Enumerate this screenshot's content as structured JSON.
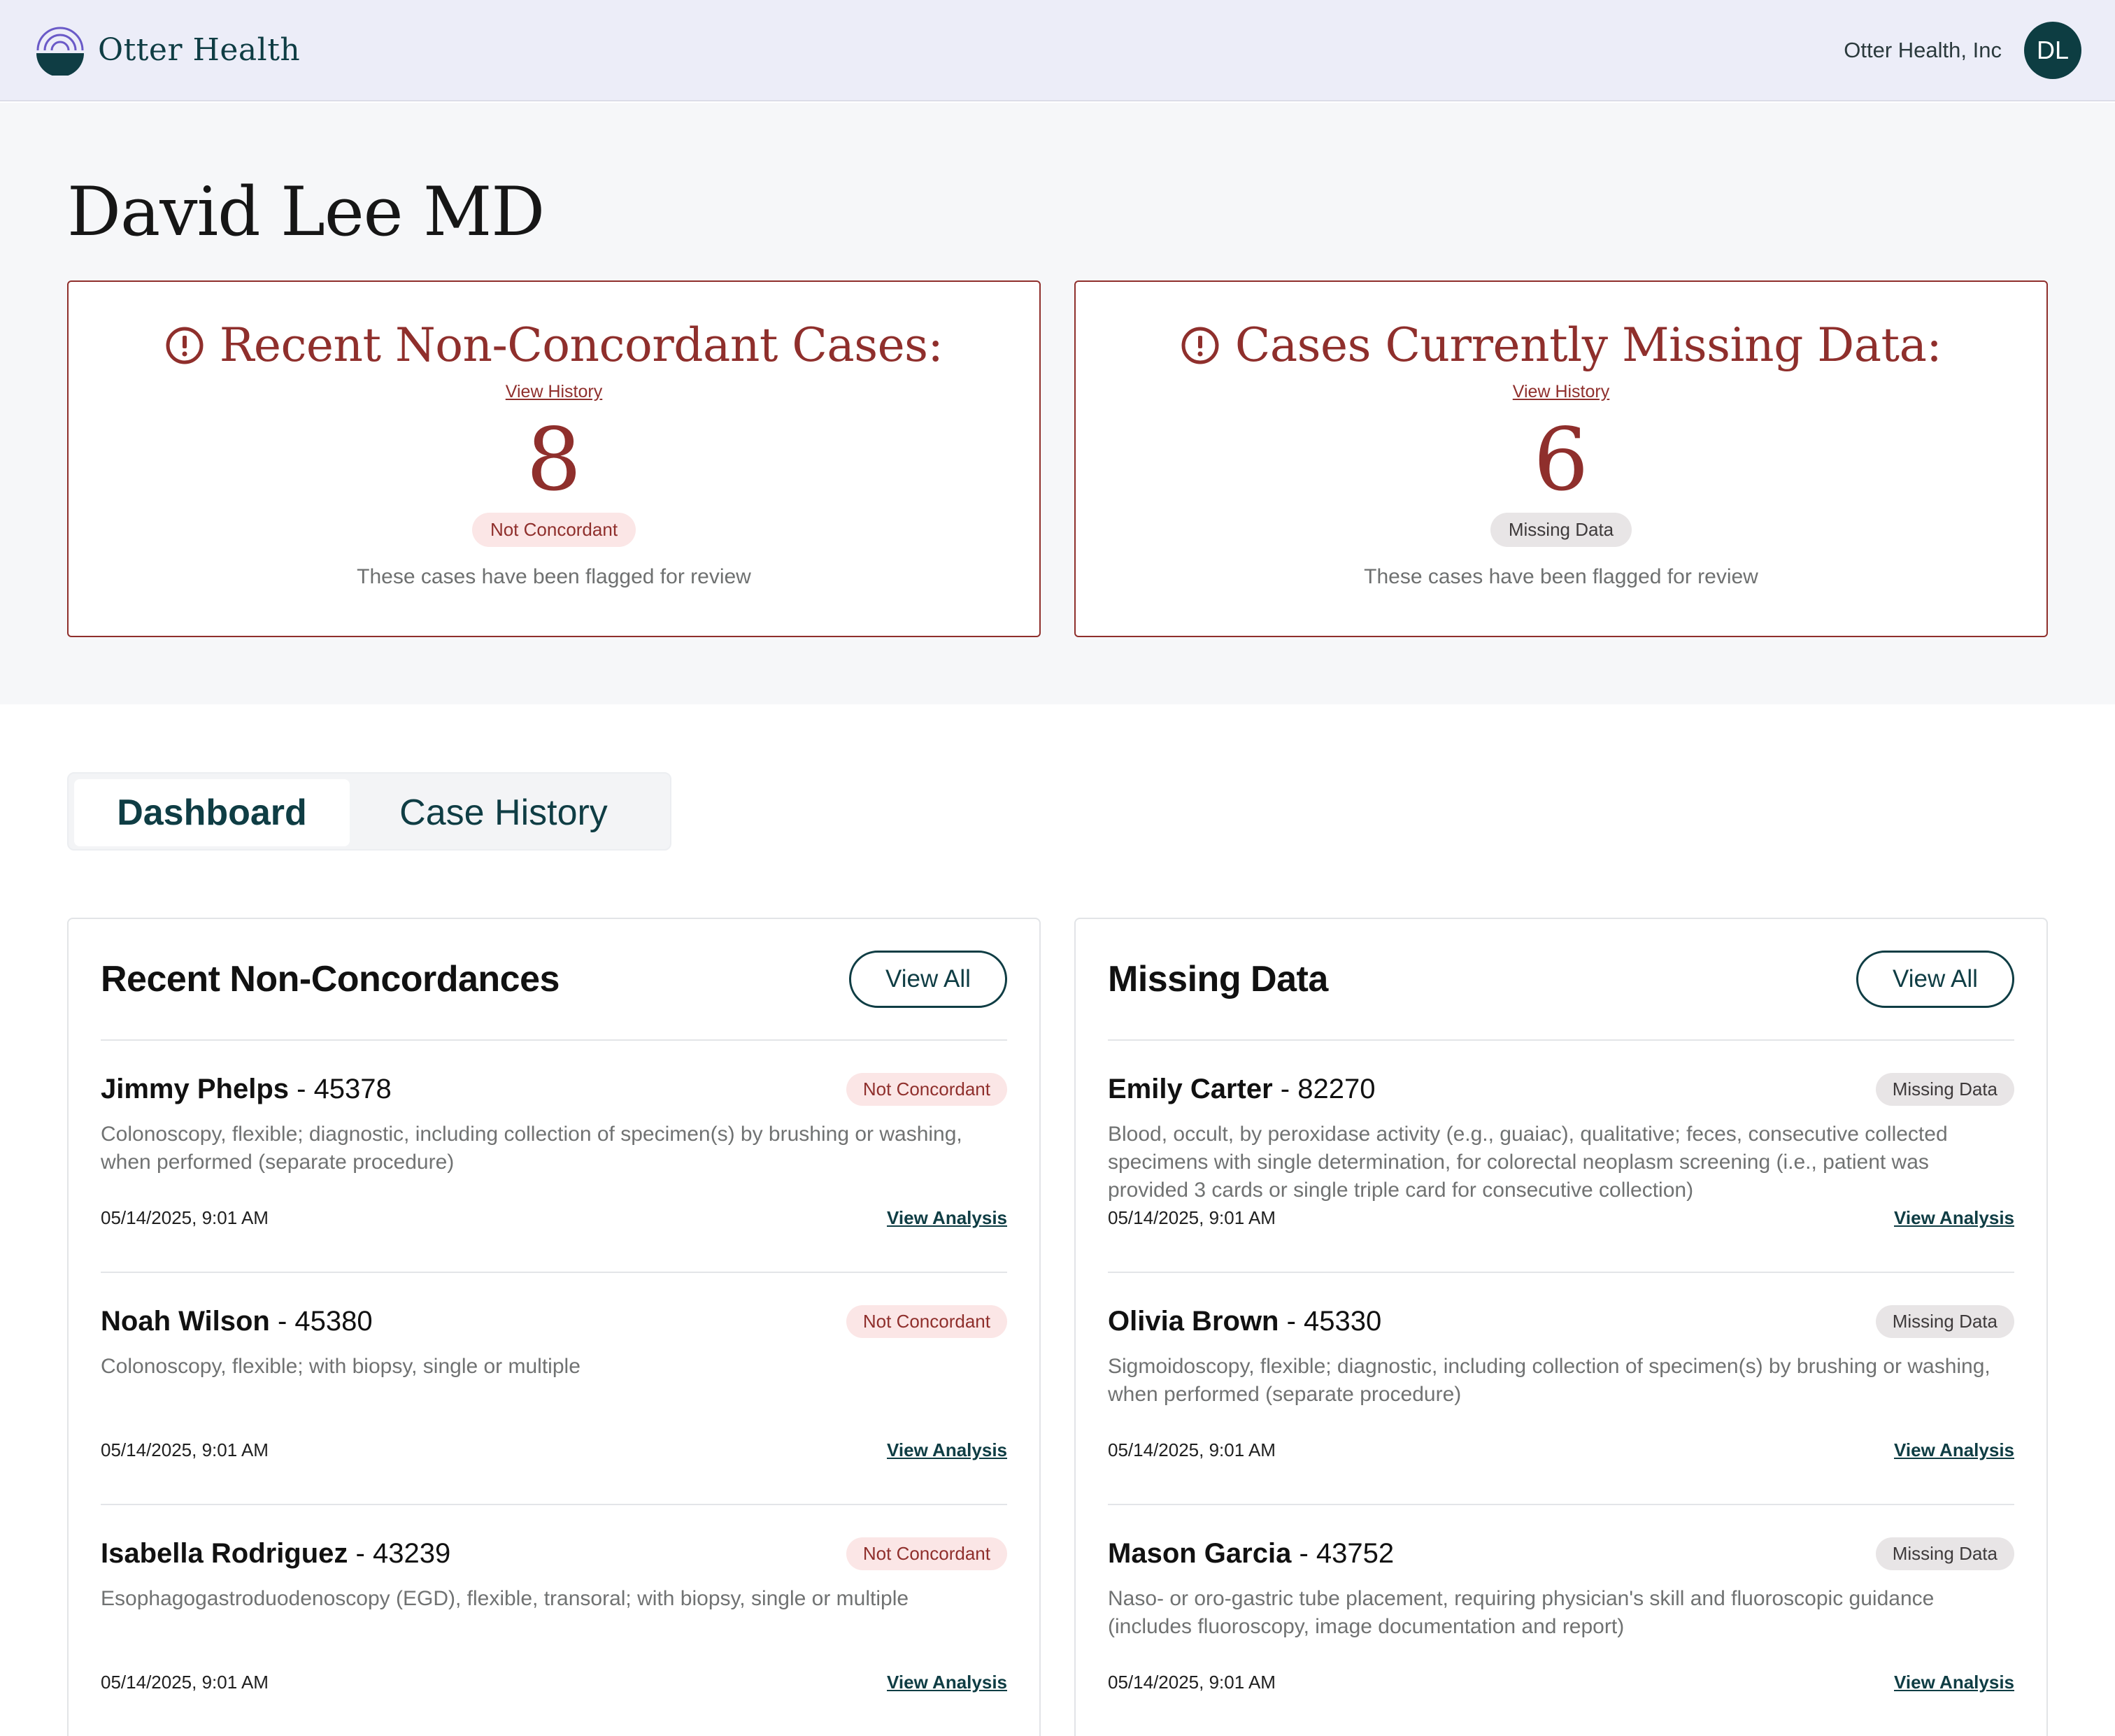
{
  "header": {
    "brand_name": "Otter Health",
    "org_name": "Otter Health, Inc",
    "avatar_initials": "DL"
  },
  "page": {
    "title": "David Lee MD"
  },
  "summary_cards": [
    {
      "title": "Recent Non-Concordant Cases:",
      "link": "View History",
      "count": "8",
      "badge": "Not Concordant",
      "note": "These cases have been flagged for review"
    },
    {
      "title": "Cases Currently Missing Data:",
      "link": "View History",
      "count": "6",
      "badge": "Missing Data",
      "note": "These cases have been flagged for review"
    }
  ],
  "tabs": [
    {
      "label": "Dashboard",
      "active": true
    },
    {
      "label": "Case History",
      "active": false
    }
  ],
  "non_concordances": {
    "title": "Recent Non-Concordances",
    "view_all": "View All",
    "rows": [
      {
        "name": "Jimmy Phelps",
        "id": "45378",
        "badge": "Not Concordant",
        "description": "Colonoscopy, flexible; diagnostic, including collection of specimen(s) by brushing or washing, when performed (separate procedure)",
        "date": "05/14/2025, 9:01 AM",
        "link": "View Analysis"
      },
      {
        "name": "Noah Wilson",
        "id": "45380",
        "badge": "Not Concordant",
        "description": "Colonoscopy, flexible; with biopsy, single or multiple",
        "date": "05/14/2025, 9:01 AM",
        "link": "View Analysis"
      },
      {
        "name": "Isabella Rodriguez",
        "id": "43239",
        "badge": "Not Concordant",
        "description": "Esophagogastroduodenoscopy (EGD), flexible, transoral; with biopsy, single or multiple",
        "date": "05/14/2025, 9:01 AM",
        "link": "View Analysis"
      }
    ]
  },
  "missing_data": {
    "title": "Missing Data",
    "view_all": "View All",
    "rows": [
      {
        "name": "Emily Carter",
        "id": "82270",
        "badge": "Missing Data",
        "description": "Blood, occult, by peroxidase activity (e.g., guaiac), qualitative; feces, consecutive collected specimens with single determination, for colorectal neoplasm screening (i.e., patient was provided 3 cards or single triple card for consecutive collection)",
        "date": "05/14/2025, 9:01 AM",
        "link": "View Analysis"
      },
      {
        "name": "Olivia Brown",
        "id": "45330",
        "badge": "Missing Data",
        "description": "Sigmoidoscopy, flexible; diagnostic, including collection of specimen(s) by brushing or washing, when performed (separate procedure)",
        "date": "05/14/2025, 9:01 AM",
        "link": "View Analysis"
      },
      {
        "name": "Mason Garcia",
        "id": "43752",
        "badge": "Missing Data",
        "description": "Naso- or oro-gastric tube placement, requiring physician's skill and fluoroscopic guidance (includes fluoroscopy, image documentation and report)",
        "date": "05/14/2025, 9:01 AM",
        "link": "View Analysis"
      }
    ]
  },
  "colors": {
    "brand_teal": "#0f3d44",
    "alert_red": "#8f2f2c",
    "header_bg": "#ecedf8",
    "hero_bg": "#f6f7f9",
    "not_concordant_bg": "#fbe6e6",
    "missing_data_bg": "#e8e5e6"
  },
  "icons": {
    "logo": "otter-arc-logo",
    "alert": "alert-circle-icon"
  }
}
